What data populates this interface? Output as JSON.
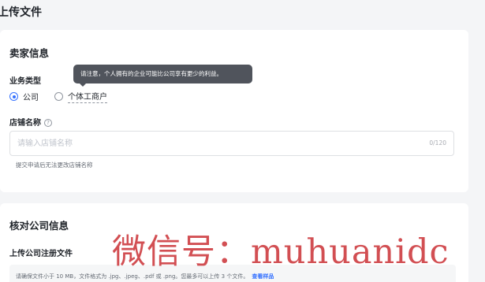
{
  "page": {
    "title": "上传文件"
  },
  "seller_section": {
    "title": "卖家信息",
    "business_type": {
      "label": "业务类型",
      "options": [
        {
          "label": "公司",
          "checked": true
        },
        {
          "label": "个体工商户",
          "checked": false
        }
      ],
      "tooltip": "请注意，个人拥有的企业可能比公司享有更少的利益。"
    },
    "store_name": {
      "label": "店铺名称",
      "help_icon": "question-circle-icon",
      "placeholder": "请输入店铺名称",
      "counter": "0/120",
      "hint": "提交申请后无法更改店铺名称"
    }
  },
  "company_section": {
    "title": "核对公司信息",
    "upload_label": "上传公司注册文件",
    "upload_hint": "请确保文件小于 10 MB，文件格式为 .jpg、.jpeg、.pdf 或 .png。您最多可以上传 3 个文件。",
    "sample_link": "查看样品"
  },
  "watermark": "微信号：muhuanidc",
  "colors": {
    "accent": "#3370ff",
    "tooltip_bg": "#50545c",
    "page_bg": "#f4f5f7",
    "watermark": "#c8282d"
  }
}
